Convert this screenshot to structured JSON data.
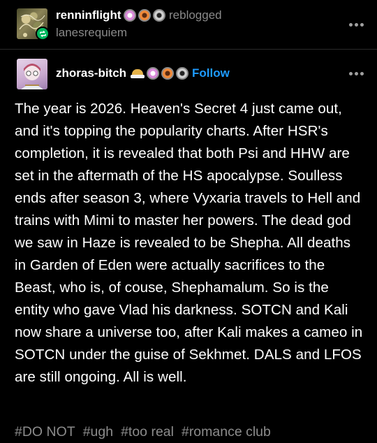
{
  "colors": {
    "background": "#000000",
    "text": "#ffffff",
    "muted": "#8a8a8a",
    "follow": "#1e9bff",
    "reblog_badge": "#00b85f"
  },
  "reblog": {
    "username": "renninflight",
    "action_label": "reblogged",
    "source_username": "lanesrequiem",
    "badge_icons": [
      "pink-badge-icon",
      "orange-badge-icon",
      "gray-badge-icon"
    ],
    "reblog_icon": "reblog-icon",
    "more_icon": "more-options-icon"
  },
  "post": {
    "username": "zhoras-bitch",
    "follow_label": "Follow",
    "badge_icons": [
      "food-emoji-icon",
      "pink-badge-icon",
      "orange-badge-icon",
      "gray-badge-icon"
    ],
    "more_icon": "more-options-icon",
    "body": "The year is 2026. Heaven's Secret 4 just came out, and it's topping the popularity charts. After HSR's completion, it is revealed that both Psi and HHW are set in the aftermath of the HS apocalypse. Soulless ends after season 3, where Vyxaria travels to Hell and trains with Mimi to master her powers. The dead god we saw in Haze is revealed to be Shepha. All deaths in Garden of Eden were actually sacrifices to the Beast, who is, of couse, Shephamalum. So is the entity who gave Vlad his darkness. SOTCN and Kali now share a universe too, after Kali makes a cameo in SOTCN under the guise of Sekhmet. DALS and LFOS are still ongoing. All is well.",
    "tags": [
      "#DO NOT",
      "#ugh",
      "#too real",
      "#romance club"
    ]
  }
}
